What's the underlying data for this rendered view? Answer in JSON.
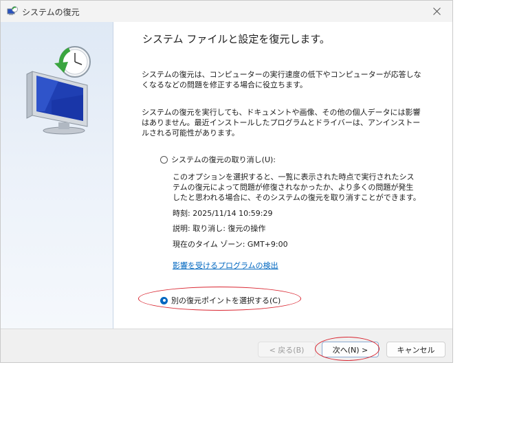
{
  "window": {
    "title": "システムの復元",
    "close_symbol": "✕"
  },
  "content": {
    "heading": "システム ファイルと設定を復元します。",
    "para1": "システムの復元は、コンピューターの実行速度の低下やコンピューターが応答しなくなるなどの問題を修正する場合に役立ちます。",
    "para2": "システムの復元を実行しても、ドキュメントや画像、その他の個人データには影響はありません。最近インストールしたプログラムとドライバーは、アンインストールされる可能性があります。"
  },
  "options": {
    "undo": {
      "label": "システムの復元の取り消し(U):",
      "checked": false,
      "description_lines": [
        "このオプションを選択すると、一覧に表示された時点で実行されたシス",
        "テムの復元によって問題が修復されなかったか、より多くの問題が発生",
        "したと思われる場合に、そのシステムの復元を取り消すことができます。"
      ],
      "time": "時刻: 2025/11/14 10:59:29",
      "description": "説明: 取り消し: 復元の操作",
      "timezone": "現在のタイム ゾーン: GMT+9:00",
      "affected_link": "影響を受けるプログラムの検出"
    },
    "other": {
      "label": "別の復元ポイントを選択する(C)",
      "checked": true
    }
  },
  "footer": {
    "back_label": "< 戻る(B)",
    "next_label": "次へ(N) >",
    "cancel_label": "キャンセル"
  },
  "colors": {
    "accent": "#0067c0",
    "annotation": "#d9232e"
  }
}
